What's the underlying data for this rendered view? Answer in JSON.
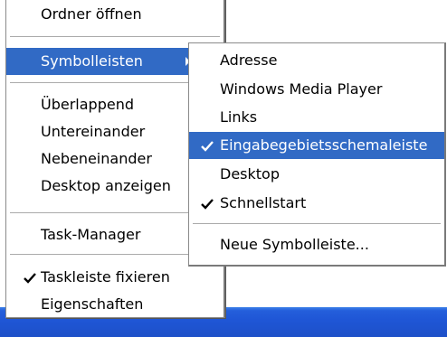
{
  "context_menu": {
    "open_folder": "Ordner öffnen",
    "toolbars": "Symbolleisten",
    "cascade": "Überlappend",
    "tile_horizontal": "Untereinander",
    "tile_vertical": "Nebeneinander",
    "show_desktop": "Desktop anzeigen",
    "task_manager": "Task-Manager",
    "lock_taskbar": "Taskleiste fixieren",
    "lock_taskbar_checked": true,
    "properties": "Eigenschaften"
  },
  "toolbars_submenu": {
    "address": "Adresse",
    "media_player": "Windows Media Player",
    "links": "Links",
    "language_bar": "Eingabegebietsschemaleiste",
    "language_bar_checked": true,
    "desktop": "Desktop",
    "quick_launch": "Schnellstart",
    "quick_launch_checked": true,
    "new_toolbar": "Neue Symbolleiste..."
  },
  "colors": {
    "highlight": "#316ac5",
    "taskbar": "#245edb"
  },
  "icons": {
    "check": "check-icon",
    "submenu_arrow": "chevron-right-icon"
  }
}
